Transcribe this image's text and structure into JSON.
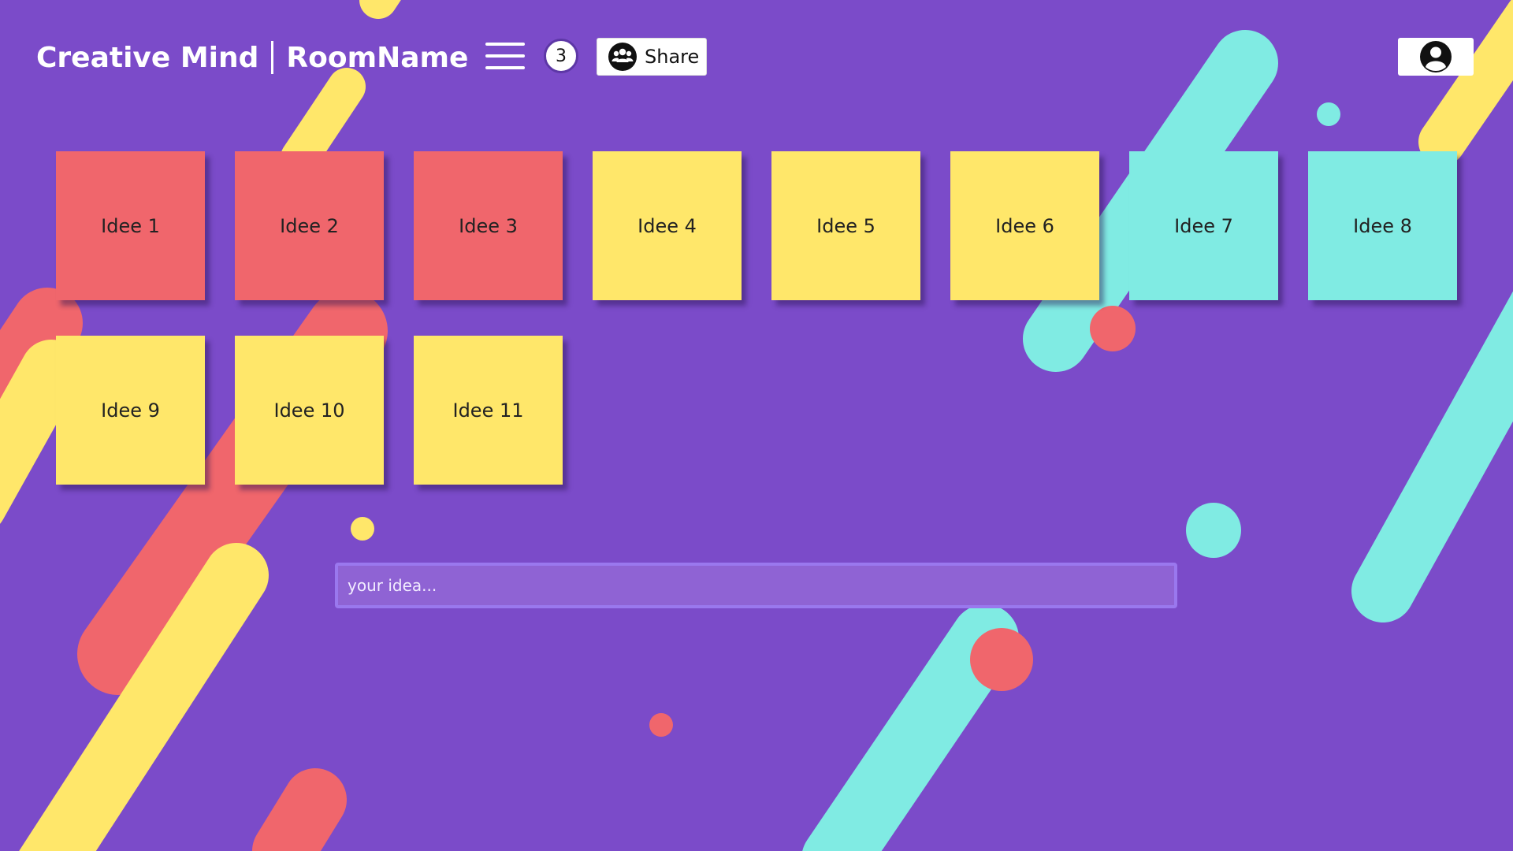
{
  "header": {
    "app_name": "Creative Mind",
    "room_name": "RoomName",
    "participant_count": "3",
    "share_label": "Share",
    "menu_icon": "hamburger-menu-icon",
    "share_icon": "people-group-icon",
    "account_icon": "user-circle-icon"
  },
  "notes": [
    {
      "label": "Idee 1",
      "color": "red"
    },
    {
      "label": "Idee 2",
      "color": "red"
    },
    {
      "label": "Idee 3",
      "color": "red"
    },
    {
      "label": "Idee 4",
      "color": "yellow"
    },
    {
      "label": "Idee 5",
      "color": "yellow"
    },
    {
      "label": "Idee 6",
      "color": "yellow"
    },
    {
      "label": "Idee 7",
      "color": "cyan"
    },
    {
      "label": "Idee 8",
      "color": "cyan"
    },
    {
      "label": "Idee 9",
      "color": "yellow"
    },
    {
      "label": "Idee 10",
      "color": "yellow"
    },
    {
      "label": "Idee 11",
      "color": "yellow"
    }
  ],
  "idea_input": {
    "placeholder": "your idea...",
    "value": ""
  },
  "colors": {
    "background": "#7b4bc9",
    "red": "#f0666c",
    "yellow": "#ffe76a",
    "cyan": "#80ebe3"
  }
}
